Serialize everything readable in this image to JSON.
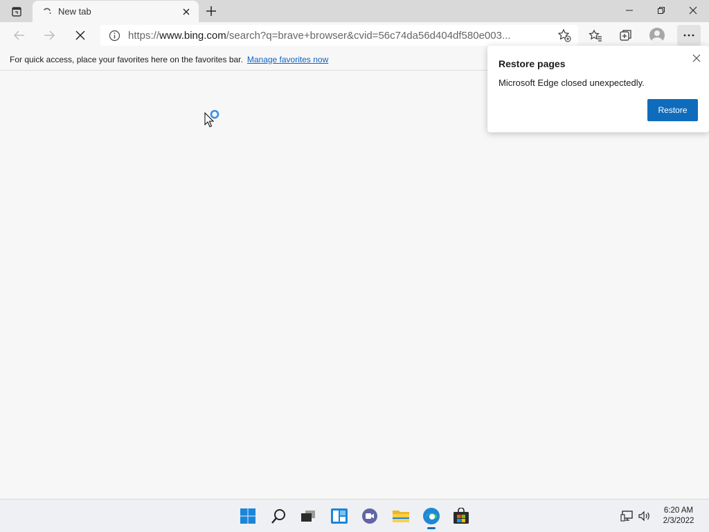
{
  "browser": {
    "tab": {
      "title": "New tab"
    },
    "address": {
      "scheme": "https://",
      "host": "www.bing.com",
      "rest": "/search?q=brave+browser&cvid=56c74da56d404df580e003..."
    }
  },
  "favorites_bar": {
    "message": "For quick access, place your favorites here on the favorites bar.",
    "link": "Manage favorites now"
  },
  "restore_popup": {
    "title": "Restore pages",
    "message": "Microsoft Edge closed unexpectedly.",
    "button": "Restore"
  },
  "taskbar": {
    "apps": [
      "start-icon",
      "search-icon",
      "task-view-icon",
      "widgets-icon",
      "chat-icon",
      "file-explorer-icon",
      "edge-icon",
      "store-icon"
    ],
    "time": "6:20 AM",
    "date": "2/3/2022"
  },
  "colors": {
    "accent": "#0f6cbd",
    "link": "#0b63c5"
  }
}
